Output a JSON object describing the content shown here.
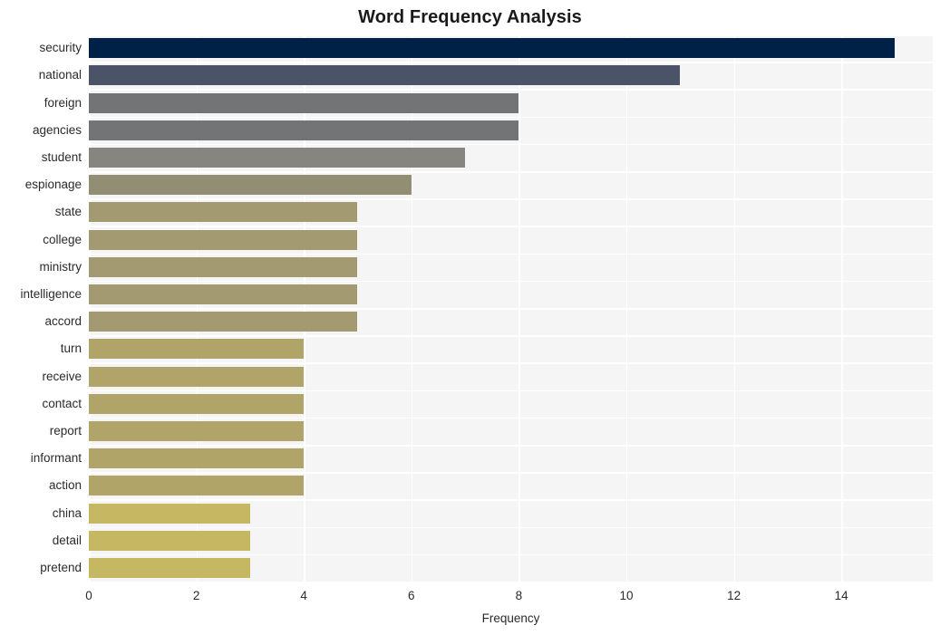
{
  "chart_data": {
    "type": "bar",
    "orientation": "horizontal",
    "title": "Word Frequency Analysis",
    "xlabel": "Frequency",
    "ylabel": "",
    "xlim": [
      0,
      15.7
    ],
    "ylim": null,
    "grid": true,
    "legend": null,
    "xticks": [
      "0",
      "2",
      "4",
      "6",
      "8",
      "10",
      "12",
      "14"
    ],
    "xtick_values": [
      0,
      2,
      4,
      6,
      8,
      10,
      12,
      14
    ],
    "categories": [
      "security",
      "national",
      "foreign",
      "agencies",
      "student",
      "espionage",
      "state",
      "college",
      "ministry",
      "intelligence",
      "accord",
      "turn",
      "receive",
      "contact",
      "report",
      "informant",
      "action",
      "china",
      "detail",
      "pretend"
    ],
    "values": [
      15,
      11,
      8,
      8,
      7,
      6,
      5,
      5,
      5,
      5,
      5,
      4,
      4,
      4,
      4,
      4,
      4,
      3,
      3,
      3
    ],
    "bar_colors": [
      "#002147",
      "#4b5369",
      "#737476",
      "#737476",
      "#86857f",
      "#918e73",
      "#a39a72",
      "#a39a72",
      "#a39a72",
      "#a39a72",
      "#a39a72",
      "#b0a468",
      "#b0a468",
      "#b0a468",
      "#b0a468",
      "#b0a468",
      "#b0a468",
      "#c6b863",
      "#c6b863",
      "#c6b863"
    ]
  },
  "style": {
    "plot_background": "#f5f5f6",
    "figure_background": "#ffffff",
    "gridline_color": "#ffffff",
    "text_color": "#2b2b2b",
    "title_color": "#1a1a1a"
  }
}
